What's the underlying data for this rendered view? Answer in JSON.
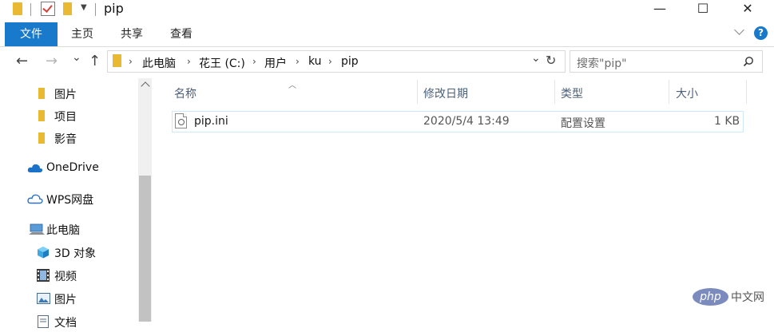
{
  "title": "pip",
  "window_controls": {
    "minimize": "—",
    "maximize": "☐",
    "close": "✕"
  },
  "ribbon": {
    "tabs": [
      "文件",
      "主页",
      "共享",
      "查看"
    ],
    "help": "?",
    "accent_color": "#1979ca"
  },
  "nav": {
    "back": "←",
    "forward": "→",
    "recent": "⌄",
    "up": "↑",
    "breadcrumb_sep": "›",
    "breadcrumb": [
      "此电脑",
      "花王 (C:)",
      "用户",
      "ku",
      "pip"
    ],
    "address_dropdown": "⌄",
    "refresh": "↻"
  },
  "search": {
    "placeholder": "搜索\"pip\"",
    "icon": "search-icon"
  },
  "sidebar": {
    "items": [
      {
        "label": "图片",
        "icon": "folder-icon"
      },
      {
        "label": "项目",
        "icon": "folder-icon"
      },
      {
        "label": "影音",
        "icon": "folder-icon"
      },
      {
        "label": "OneDrive",
        "icon": "cloud-icon"
      },
      {
        "label": "WPS网盘",
        "icon": "cloud-outline-icon"
      },
      {
        "label": "此电脑",
        "icon": "computer-icon"
      },
      {
        "label": "3D 对象",
        "icon": "cube-icon"
      },
      {
        "label": "视频",
        "icon": "film-icon"
      },
      {
        "label": "图片",
        "icon": "picture-icon"
      },
      {
        "label": "文档",
        "icon": "document-icon"
      }
    ]
  },
  "columns": [
    "名称",
    "修改日期",
    "类型",
    "大小"
  ],
  "files": [
    {
      "name": "pip.ini",
      "modified": "2020/5/4 13:49",
      "type": "配置设置",
      "size": "1 KB",
      "icon": "config-file-icon"
    }
  ],
  "watermark": {
    "logo": "php",
    "text": "中文网"
  }
}
